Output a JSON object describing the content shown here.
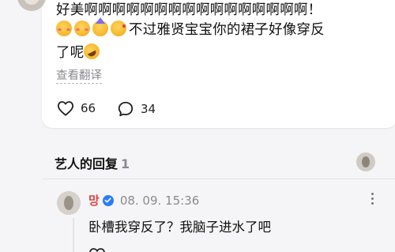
{
  "post": {
    "line1": "好美啊啊啊啊啊啊啊啊啊啊啊啊啊啊啊啊！",
    "line2_text": "不过雅贤宝宝你的裙子好像穿反",
    "line3_text": "了呢",
    "emojis_line2": [
      "smiling-face-with-hearts-icon",
      "smiling-face-with-hearts-icon",
      "partying-face-icon",
      "kissing-face-icon"
    ],
    "emoji_line3": "rolling-on-floor-laughing-icon",
    "translate_label": "查看翻译",
    "like_count": "66",
    "comment_count": "34"
  },
  "replies_section": {
    "title": "艺人的回复",
    "count": "1"
  },
  "reply": {
    "author": "망",
    "verified": true,
    "date": "08. 09. 15:36",
    "text": "卧槽我穿反了？我脑子进水了吧"
  },
  "colors": {
    "background": "#f5f5f7",
    "card": "#ffffff",
    "author_red": "#e0413f",
    "verified_blue": "#2b7cf6",
    "muted_text": "#8a8a8f"
  }
}
